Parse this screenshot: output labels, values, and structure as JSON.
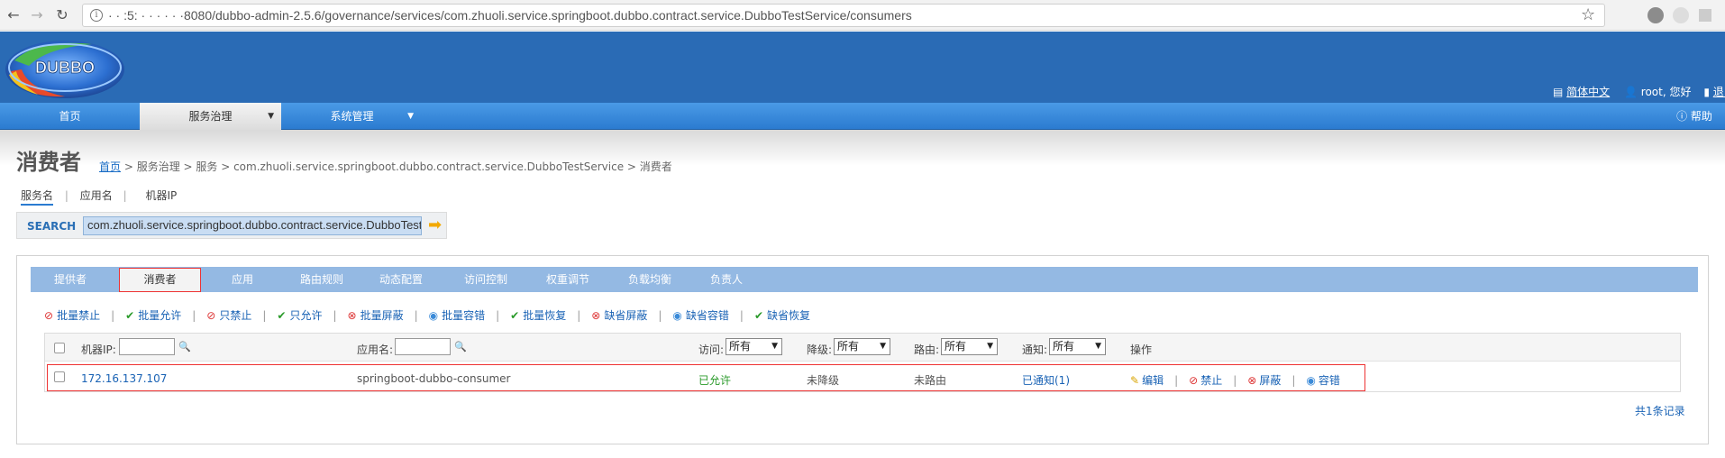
{
  "browser": {
    "url": "· · :5: · · · · · ·8080/dubbo-admin-2.5.6/governance/services/com.zhuoli.service.springboot.dubbo.contract.service.DubboTestService/consumers"
  },
  "header": {
    "logo_text": "DUBBO",
    "lang_link": "简体中文",
    "user_text": "root, 您好",
    "logout_link": "退出"
  },
  "main_nav": {
    "items": [
      {
        "label": "首页"
      },
      {
        "label": "服务治理",
        "active": true
      },
      {
        "label": "系统管理"
      }
    ],
    "help": "帮助"
  },
  "page": {
    "title": "消费者",
    "breadcrumb": {
      "home": "首页",
      "rest": " > 服务治理 > 服务 > com.zhuoli.service.springboot.dubbo.contract.service.DubboTestService > 消费者"
    }
  },
  "search": {
    "tabs": [
      "服务名",
      "应用名",
      "机器IP"
    ],
    "label": "SEARCH",
    "value": "com.zhuoli.service.springboot.dubbo.contract.service.DubboTestService"
  },
  "tabs": [
    "提供者",
    "消费者",
    "应用",
    "路由规则",
    "动态配置",
    "访问控制",
    "权重调节",
    "负载均衡",
    "负责人"
  ],
  "actions": [
    {
      "label": "批量禁止",
      "icon": "forbid-icon"
    },
    {
      "label": "批量允许",
      "icon": "check-icon"
    },
    {
      "label": "只禁止",
      "icon": "forbid-icon"
    },
    {
      "label": "只允许",
      "icon": "check-icon"
    },
    {
      "label": "批量屏蔽",
      "icon": "block-icon"
    },
    {
      "label": "批量容错",
      "icon": "tolerance-icon"
    },
    {
      "label": "批量恢复",
      "icon": "check-icon"
    },
    {
      "label": "缺省屏蔽",
      "icon": "block-icon"
    },
    {
      "label": "缺省容错",
      "icon": "tolerance-icon"
    },
    {
      "label": "缺省恢复",
      "icon": "check-icon"
    }
  ],
  "table": {
    "headers": {
      "ip": "机器IP:",
      "app": "应用名:",
      "access": "访问:",
      "degrade": "降级:",
      "route": "路由:",
      "notify": "通知:",
      "ops": "操作"
    },
    "select_default": "所有",
    "rows": [
      {
        "ip": "172.16.137.107",
        "app": "springboot-dubbo-consumer",
        "access": "已允许",
        "degrade": "未降级",
        "route": "未路由",
        "notify": "已通知(1)",
        "ops": [
          "编辑",
          "禁止",
          "屏蔽",
          "容错"
        ]
      }
    ]
  },
  "footer": {
    "count": "共1条记录"
  }
}
